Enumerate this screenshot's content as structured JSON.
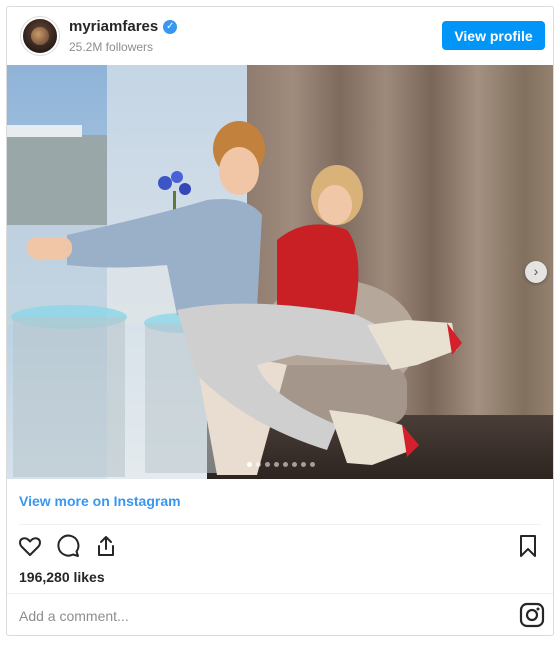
{
  "header": {
    "username": "myriamfares",
    "verified_mark": "✓",
    "followers": "25.2M followers",
    "view_profile_label": "View profile"
  },
  "photo": {
    "next_arrow": "›",
    "carousel_dots": 8,
    "active_dot": 0
  },
  "footer": {
    "view_more_label": "View more on Instagram",
    "likes": "196,280 likes",
    "comment_placeholder": "Add a comment..."
  },
  "icons": {
    "like": "heart-icon",
    "comment": "comment-icon",
    "share": "share-icon",
    "save": "bookmark-icon",
    "brand": "instagram-icon"
  },
  "colors": {
    "accent": "#0095f6",
    "link": "#3897f0",
    "muted": "#8e8e8e",
    "border": "#dbdbdb"
  }
}
